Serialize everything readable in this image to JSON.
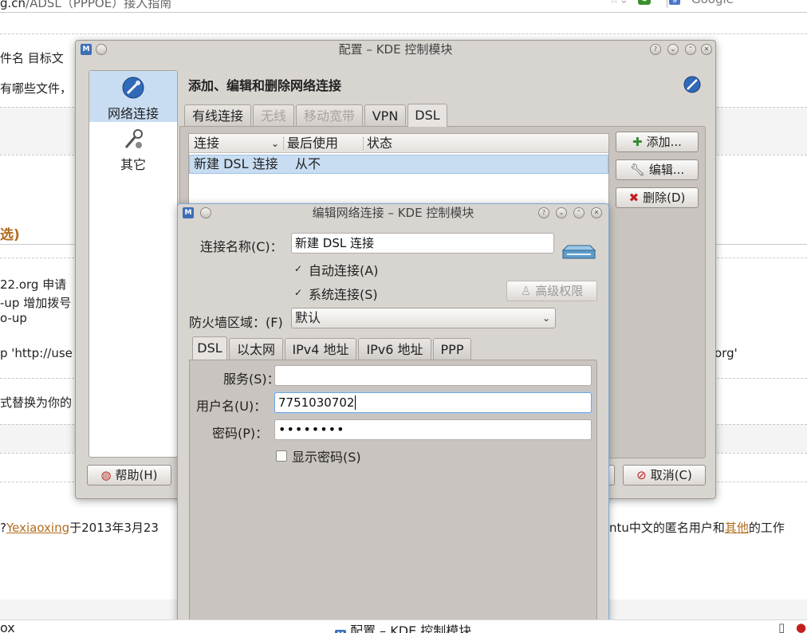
{
  "browser": {
    "url_host": "g.cn",
    "url_path": "/ADSL（PPPOE）接入指南",
    "search_placeholder": "Google",
    "search_engine_icon": "google-g-icon"
  },
  "page": {
    "line1": "件名 目标文",
    "line2": "有哪些文件，",
    "heading_partial": "选)",
    "line3": "22.org 申请",
    "line4": "-up 增加拨号",
    "line5": "o-up",
    "line6": "p 'http://use",
    "line6_right": "org'",
    "line7": "式替换为你的",
    "footer_prefix": "?",
    "footer_author": "Yexiaoxing",
    "footer_date": "于2013年3月23",
    "footer_right_a": "ntu中文的匿名用户和",
    "footer_right_link": "其他",
    "footer_right_b": "的工作"
  },
  "main_window": {
    "title": "配置 – KDE 控制模块",
    "sidebar": [
      {
        "label": "网络连接",
        "icon": "network-connections-icon"
      },
      {
        "label": "其它",
        "icon": "tools-icon"
      }
    ],
    "header": "添加、编辑和删除网络连接",
    "tabs": [
      {
        "label": "有线连接",
        "enabled": true
      },
      {
        "label": "无线",
        "enabled": false
      },
      {
        "label": "移动宽带",
        "enabled": false
      },
      {
        "label": "VPN",
        "enabled": true
      },
      {
        "label": "DSL",
        "enabled": true,
        "selected": true
      }
    ],
    "columns": [
      "连接",
      "最后使用",
      "状态"
    ],
    "rows": [
      {
        "name": "新建 DSL 连接",
        "last_used": "从不",
        "status": ""
      }
    ],
    "add_button": "添加...",
    "edit_button": "编辑...",
    "delete_button": "删除(D)",
    "help_button": "帮助(H)",
    "cancel_button": "取消(C)"
  },
  "edit_dialog": {
    "title": "编辑网络连接 – KDE 控制模块",
    "name_label": "连接名称(C)：",
    "name_value": "新建 DSL 连接",
    "auto_connect_label": "自动连接(A)",
    "auto_connect": true,
    "system_connection_label": "系统连接(S)",
    "system_connection": true,
    "advanced_button": "高级权限",
    "firewall_label": "防火墙区域：(F)",
    "firewall_value": "默认",
    "tabs": [
      "DSL",
      "以太网",
      "IPv4 地址",
      "IPv6 地址",
      "PPP"
    ],
    "service_label": "服务(S)：",
    "service_value": "",
    "username_label": "用户名(U)：",
    "username_value": "7751030702",
    "password_label": "密码(P)：",
    "password_value": "••••••••",
    "show_password_label": "显示密码(S)",
    "show_password": false
  },
  "taskbar": {
    "left_text": "ox",
    "task_title": "配置 – KDE 控制模块"
  },
  "colors": {
    "window_bg": "#d8d4d0",
    "selection": "#c8ddf2",
    "link": "#b26c1e",
    "delete_red": "#c0201f"
  }
}
